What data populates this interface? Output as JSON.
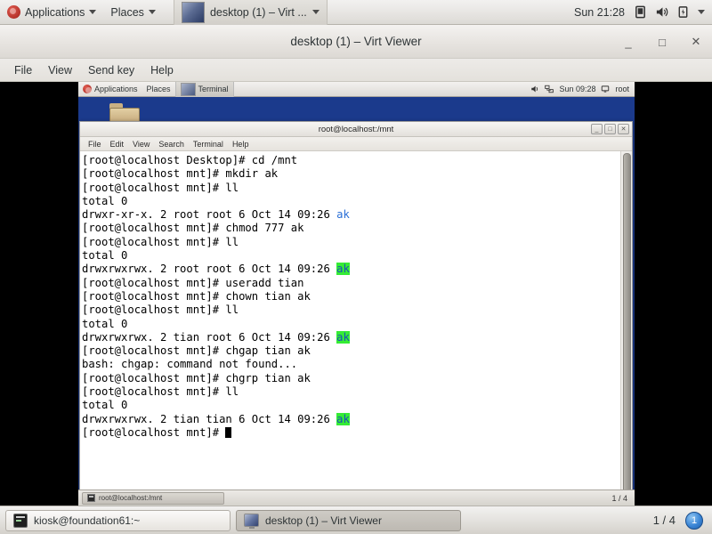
{
  "host_panel": {
    "applications_label": "Applications",
    "places_label": "Places",
    "window_label": "desktop (1) – Virt ...",
    "clock": "Sun 21:28"
  },
  "virt_viewer": {
    "title": "desktop (1) – Virt Viewer",
    "window_buttons": {
      "minimize": "_",
      "maximize": "□",
      "close": "✕"
    },
    "menus": [
      "File",
      "View",
      "Send key",
      "Help"
    ]
  },
  "guest": {
    "panel": {
      "applications_label": "Applications",
      "places_label": "Places",
      "window_label": "Terminal",
      "clock": "Sun 09:28",
      "user": "root"
    },
    "desktop_icon_label": "",
    "taskbar": {
      "window_button": "root@localhost:/mnt",
      "pager": "1 / 4"
    },
    "terminal": {
      "title": "root@localhost:/mnt",
      "window_buttons": {
        "minimize": "_",
        "maximize": "□",
        "close": "✕"
      },
      "menus": [
        "File",
        "Edit",
        "View",
        "Search",
        "Terminal",
        "Help"
      ],
      "lines": [
        {
          "text": "[root@localhost Desktop]# cd /mnt"
        },
        {
          "text": "[root@localhost mnt]# mkdir ak"
        },
        {
          "text": "[root@localhost mnt]# ll"
        },
        {
          "text": "total 0"
        },
        {
          "text": "drwxr-xr-x. 2 root root 6 Oct 14 09:26 ",
          "dir": "ak",
          "dir_style": "plain"
        },
        {
          "text": "[root@localhost mnt]# chmod 777 ak"
        },
        {
          "text": "[root@localhost mnt]# ll"
        },
        {
          "text": "total 0"
        },
        {
          "text": "drwxrwxrwx. 2 root root 6 Oct 14 09:26 ",
          "dir": "ak",
          "dir_style": "world-writable"
        },
        {
          "text": "[root@localhost mnt]# useradd tian"
        },
        {
          "text": "[root@localhost mnt]# chown tian ak"
        },
        {
          "text": "[root@localhost mnt]# ll"
        },
        {
          "text": "total 0"
        },
        {
          "text": "drwxrwxrwx. 2 tian root 6 Oct 14 09:26 ",
          "dir": "ak",
          "dir_style": "world-writable"
        },
        {
          "text": "[root@localhost mnt]# chgap tian ak"
        },
        {
          "text": "bash: chgap: command not found..."
        },
        {
          "text": "[root@localhost mnt]# chgrp tian ak"
        },
        {
          "text": "[root@localhost mnt]# ll"
        },
        {
          "text": "total 0"
        },
        {
          "text": "drwxrwxrwx. 2 tian tian 6 Oct 14 09:26 ",
          "dir": "ak",
          "dir_style": "world-writable"
        },
        {
          "text": "[root@localhost mnt]# ",
          "cursor": true
        }
      ]
    }
  },
  "host_taskbar": {
    "buttons": [
      {
        "label": "kiosk@foundation61:~",
        "icon": "terminal-icon",
        "active": false
      },
      {
        "label": "desktop (1) – Virt Viewer",
        "icon": "monitor-icon",
        "active": true
      }
    ],
    "pager": "1 / 4",
    "workspace": "1"
  },
  "colors": {
    "guest_desktop_blue": "#1b3a8c",
    "dir_blue": "#2a6fd6",
    "world_writable_bg": "#35ec35",
    "panel_gray": "#e8e6e3",
    "workspace_blue": "#3b86d6"
  }
}
